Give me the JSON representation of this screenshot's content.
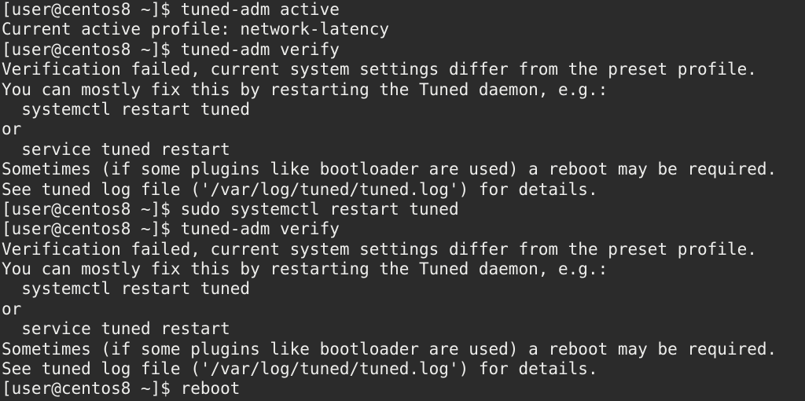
{
  "terminal": {
    "background_color": "#2b2b2b",
    "text_color": "#eeeeec",
    "lines": [
      "[user@centos8 ~]$ tuned-adm active",
      "Current active profile: network-latency",
      "[user@centos8 ~]$ tuned-adm verify",
      "Verification failed, current system settings differ from the preset profile.",
      "You can mostly fix this by restarting the Tuned daemon, e.g.:",
      "  systemctl restart tuned",
      "or",
      "  service tuned restart",
      "Sometimes (if some plugins like bootloader are used) a reboot may be required.",
      "See tuned log file ('/var/log/tuned/tuned.log') for details.",
      "[user@centos8 ~]$ sudo systemctl restart tuned",
      "[user@centos8 ~]$ tuned-adm verify",
      "Verification failed, current system settings differ from the preset profile.",
      "You can mostly fix this by restarting the Tuned daemon, e.g.:",
      "  systemctl restart tuned",
      "or",
      "  service tuned restart",
      "Sometimes (if some plugins like bootloader are used) a reboot may be required.",
      "See tuned log file ('/var/log/tuned/tuned.log') for details.",
      "[user@centos8 ~]$ reboot"
    ]
  }
}
